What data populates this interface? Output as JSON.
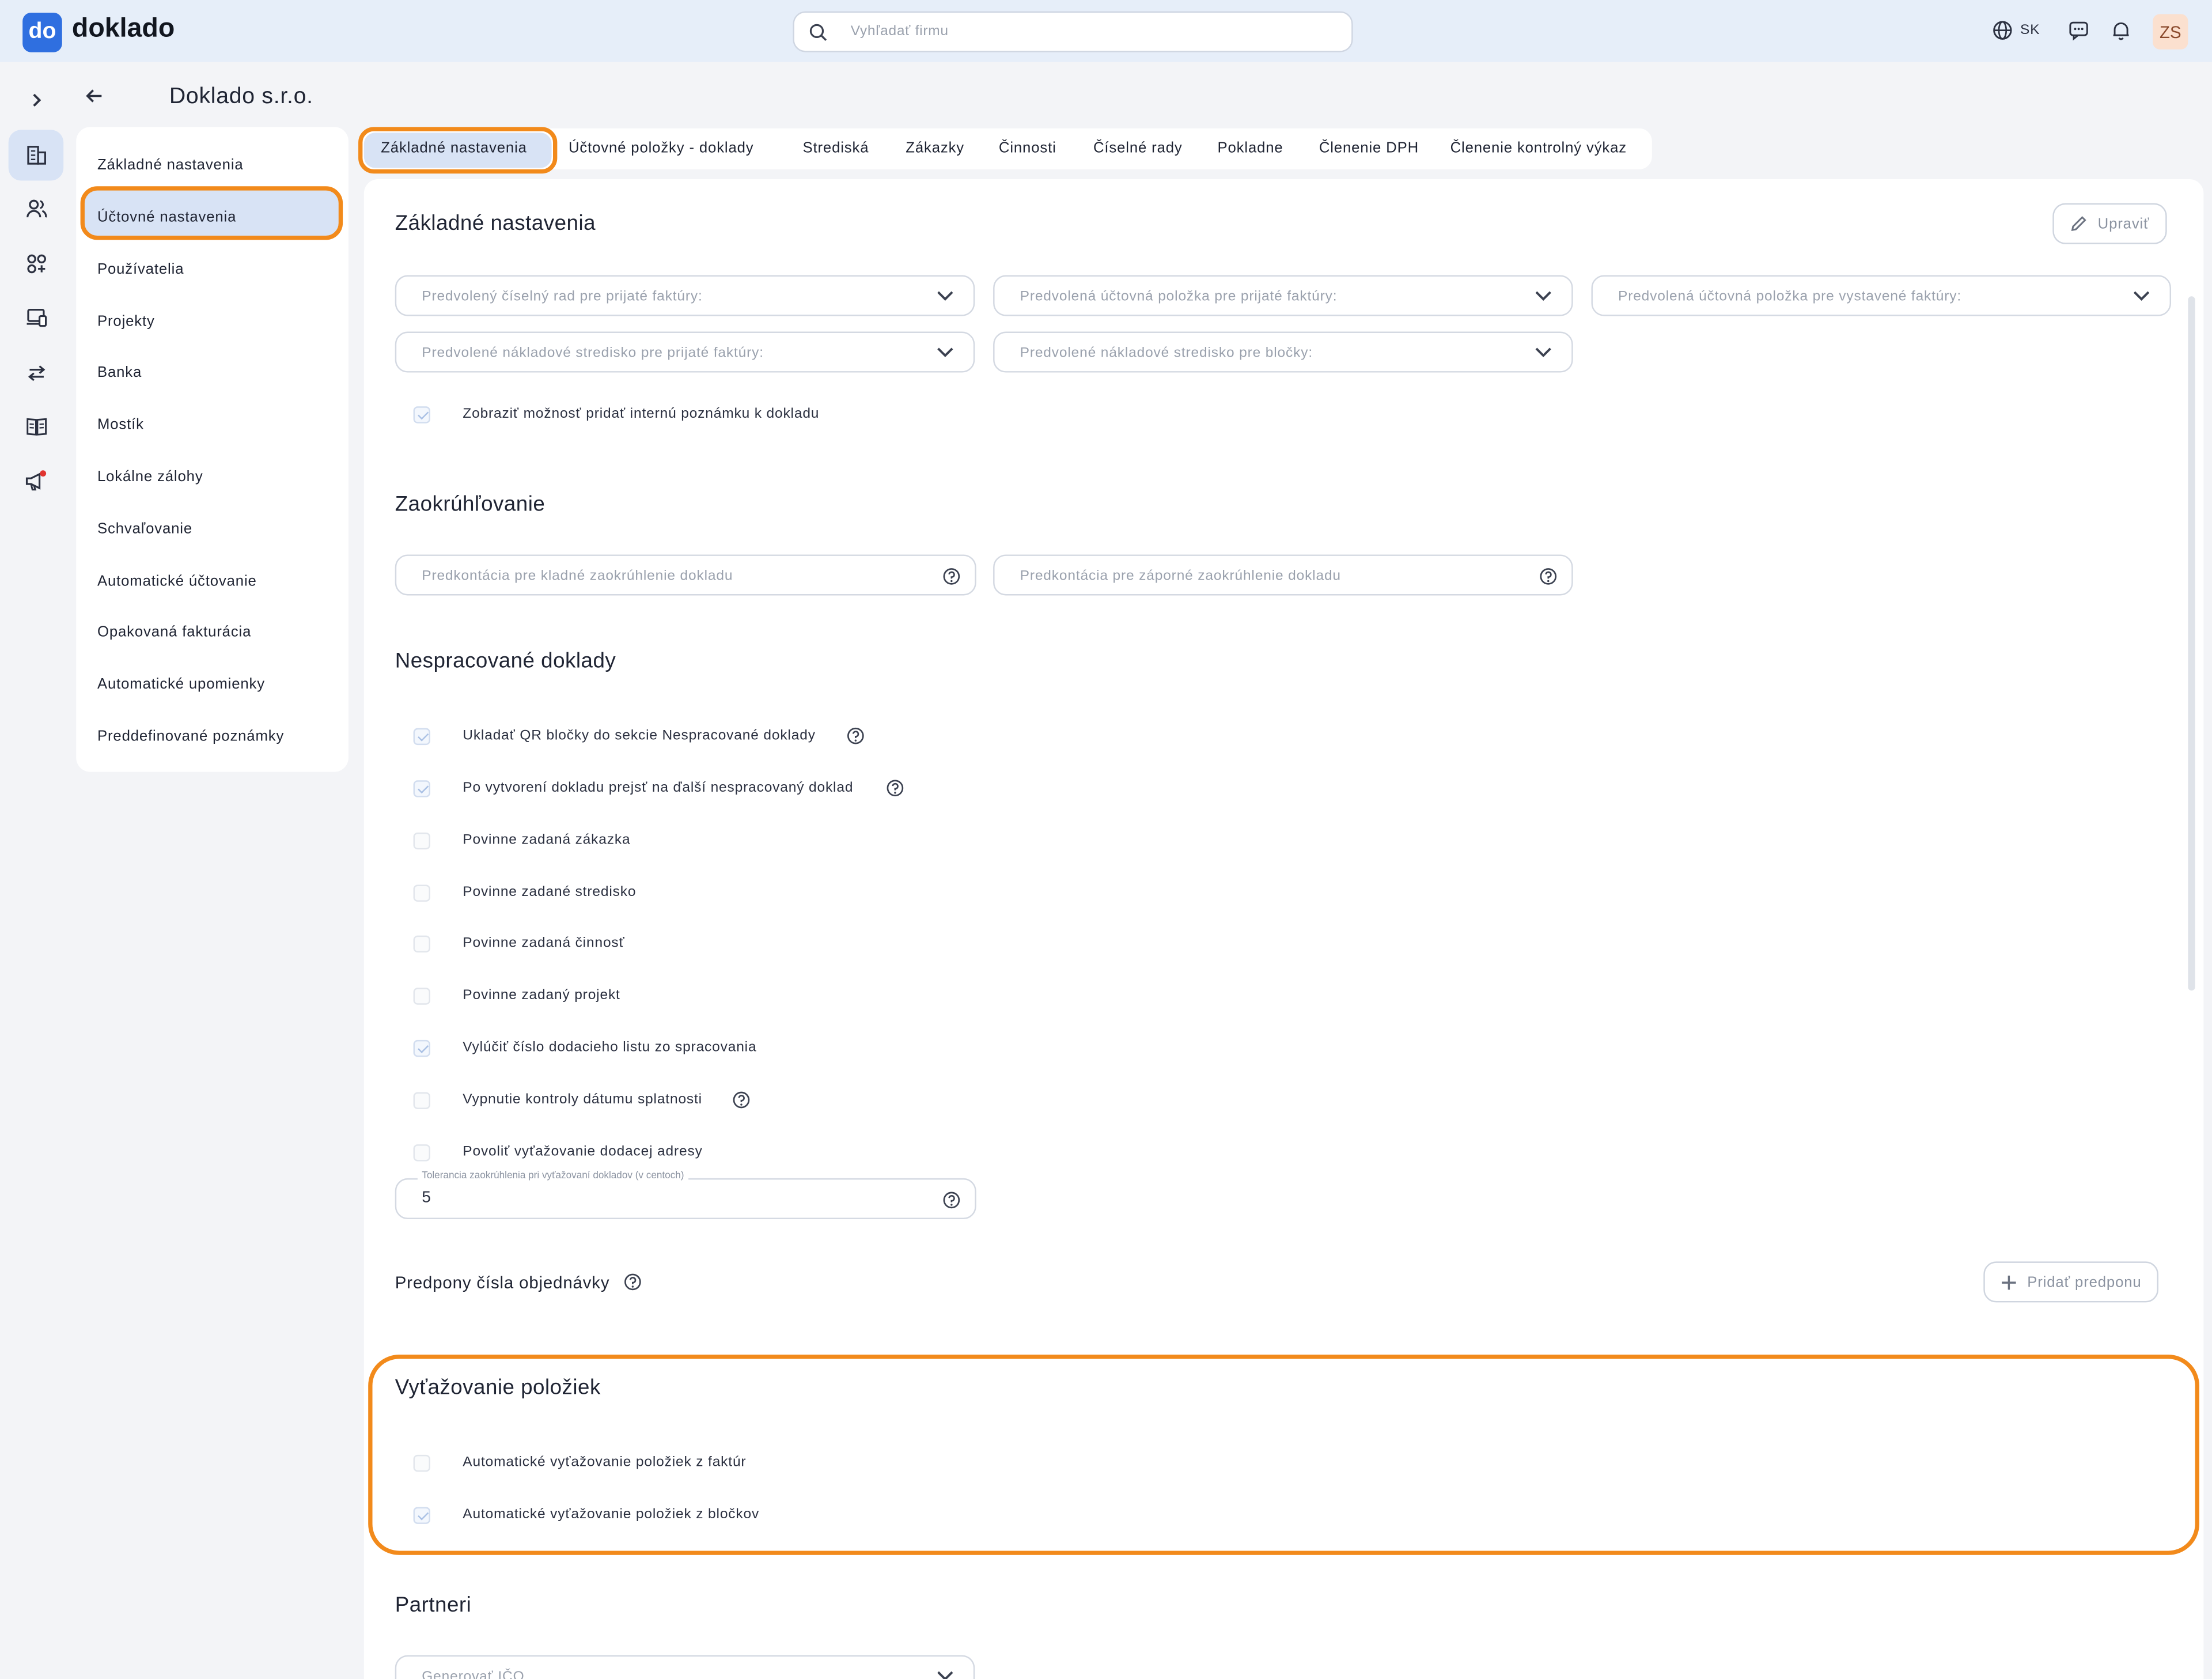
{
  "header": {
    "logo_text": "do",
    "brand": "doklado",
    "search_placeholder": "Vyhľadať firmu",
    "language": "SK",
    "avatar_initials": "ZS"
  },
  "page": {
    "title": "Doklado s.r.o."
  },
  "left_nav": {
    "items": [
      {
        "label": "Základné nastavenia"
      },
      {
        "label": "Účtovné nastavenia",
        "active": true
      },
      {
        "label": "Používatelia"
      },
      {
        "label": "Projekty"
      },
      {
        "label": "Banka"
      },
      {
        "label": "Mostík"
      },
      {
        "label": "Lokálne zálohy"
      },
      {
        "label": "Schvaľovanie"
      },
      {
        "label": "Automatické účtovanie"
      },
      {
        "label": "Opakovaná fakturácia"
      },
      {
        "label": "Automatické upomienky"
      },
      {
        "label": "Preddefinované poznámky"
      }
    ]
  },
  "tabs": [
    {
      "label": "Základné nastavenia",
      "active": true
    },
    {
      "label": "Účtovné položky - doklady"
    },
    {
      "label": "Strediská"
    },
    {
      "label": "Zákazky"
    },
    {
      "label": "Činnosti"
    },
    {
      "label": "Číselné rady"
    },
    {
      "label": "Pokladne"
    },
    {
      "label": "Členenie DPH"
    },
    {
      "label": "Členenie kontrolný výkaz"
    }
  ],
  "sections": {
    "basic": {
      "title": "Základné nastavenia",
      "edit_button": "Upraviť",
      "dropdowns": [
        "Predvolený číselný rad pre prijaté faktúry:",
        "Predvolená účtovná položka pre prijaté faktúry:",
        "Predvolená účtovná položka pre vystavené faktúry:",
        "Predvolené nákladové stredisko pre prijaté faktúry:",
        "Predvolené nákladové stredisko pre bločky:"
      ],
      "checkbox": {
        "label": "Zobraziť možnosť pridať internú poznámku k dokladu",
        "checked": true
      }
    },
    "rounding": {
      "title": "Zaokrúhľovanie",
      "fields": [
        "Predkontácia pre kladné zaokrúhlenie dokladu",
        "Predkontácia pre záporné zaokrúhlenie dokladu"
      ]
    },
    "unprocessed": {
      "title": "Nespracované doklady",
      "checkboxes": [
        {
          "label": "Ukladať QR bločky do sekcie Nespracované doklady",
          "checked": true
        },
        {
          "label": "Po vytvorení dokladu prejsť na ďalší nespracovaný doklad",
          "checked": true
        },
        {
          "label": "Povinne zadaná zákazka",
          "checked": false
        },
        {
          "label": "Povinne zadané stredisko",
          "checked": false
        },
        {
          "label": "Povinne zadaná činnosť",
          "checked": false
        },
        {
          "label": "Povinne zadaný projekt",
          "checked": false
        },
        {
          "label": "Vylúčiť číslo dodacieho listu zo spracovania",
          "checked": true
        },
        {
          "label": "Vypnutie kontroly dátumu splatnosti",
          "checked": false
        },
        {
          "label": "Povoliť vyťažovanie dodacej adresy",
          "checked": false
        }
      ],
      "tolerance": {
        "label": "Tolerancia zaokrúhlenia pri vyťažovaní dokladov (v centoch)",
        "value": "5"
      }
    },
    "prefix": {
      "title": "Predpony čísla objednávky",
      "add_button": "Pridať predponu"
    },
    "extraction": {
      "title": "Vyťažovanie položiek",
      "checkboxes": [
        {
          "label": "Automatické vyťažovanie položiek z faktúr",
          "checked": false
        },
        {
          "label": "Automatické vyťažovanie položiek z bločkov",
          "checked": true
        }
      ]
    },
    "partners": {
      "title": "Partneri",
      "field": "Generovať IČO"
    }
  },
  "colors": {
    "accent": "#2f6fe0",
    "highlight": "#f28a1b",
    "active_bg": "#d8e3f5"
  },
  "icons": [
    "search-icon",
    "globe-icon",
    "chat-icon",
    "bell-icon",
    "chevron-right-icon",
    "building-icon",
    "users-icon",
    "apps-icon",
    "devices-icon",
    "transfer-icon",
    "book-icon",
    "megaphone-icon",
    "arrow-left-icon",
    "chevron-down-icon",
    "help-icon",
    "pencil-icon",
    "plus-icon"
  ]
}
